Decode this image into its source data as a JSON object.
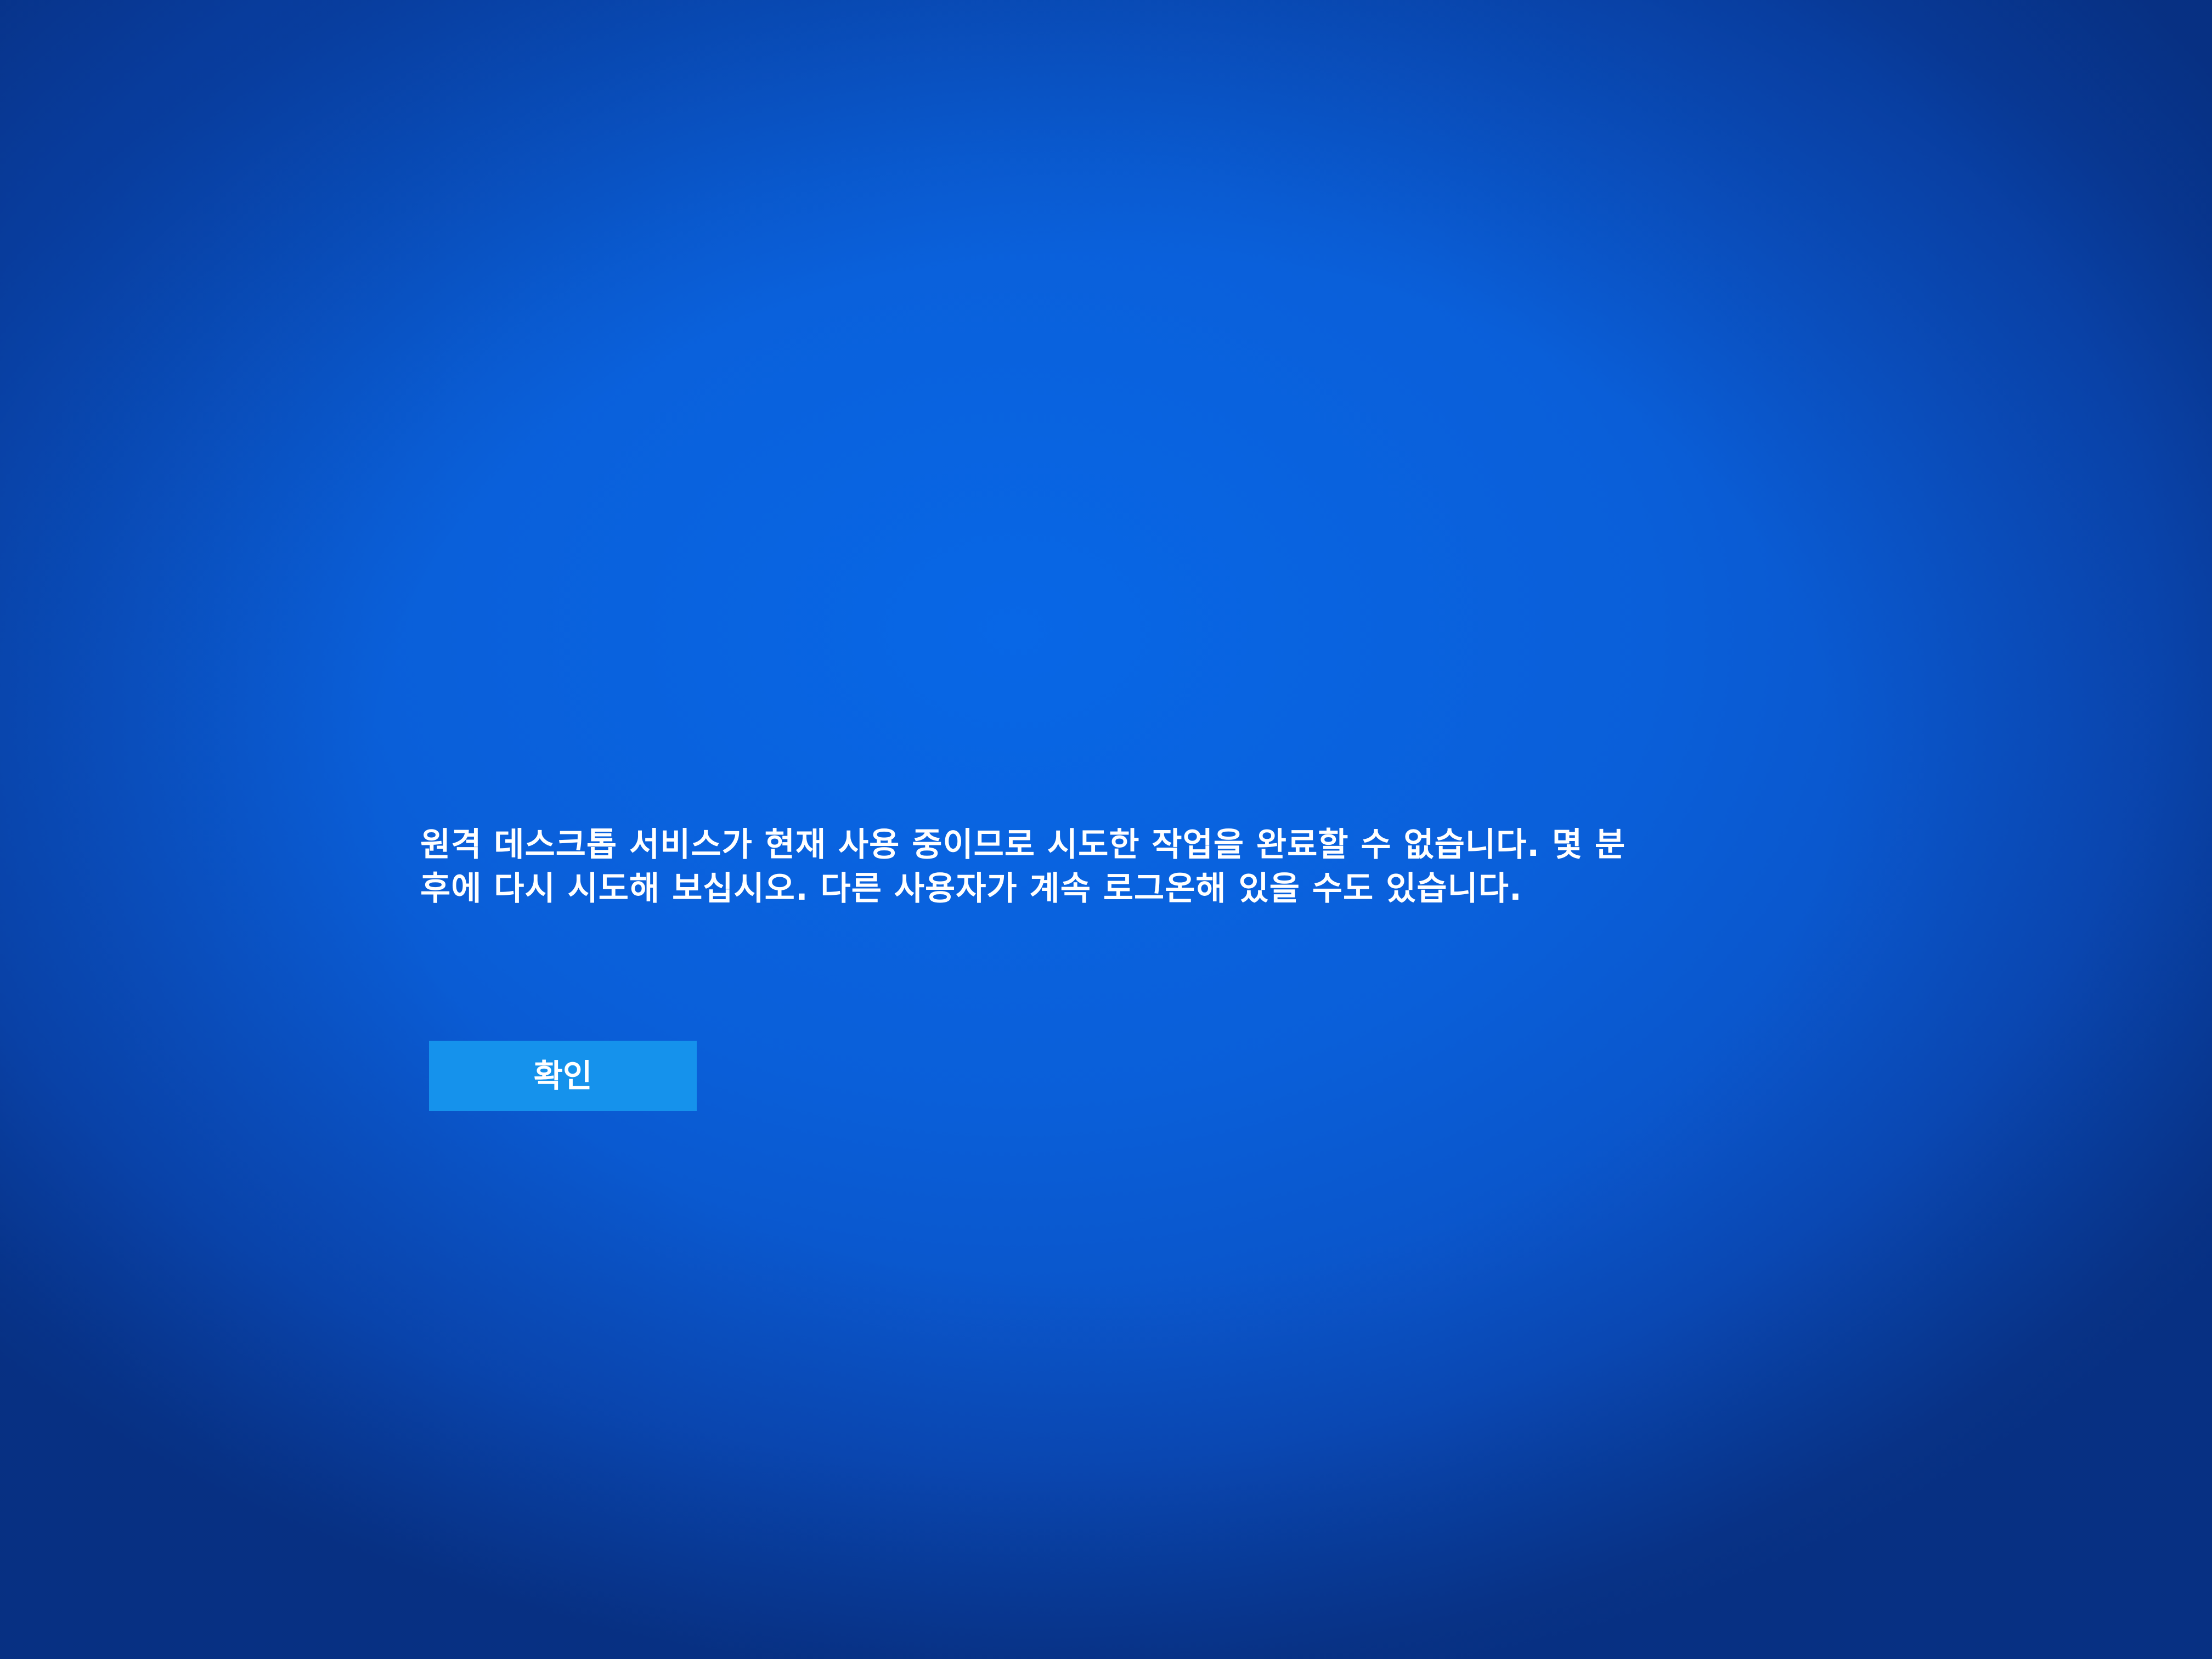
{
  "dialog": {
    "message_line_1": "원격 데스크톱 서비스가 현재 사용 중이므로 시도한 작업을 완료할 수 없습니다. 몇 분",
    "message_line_2": "후에 다시 시도해 보십시오. 다른 사용자가 계속 로그온해 있을 수도 있습니다.",
    "ok_label": "확인"
  },
  "colors": {
    "background": "#0a5fd8",
    "button": "#1592ec",
    "text": "#ffffff"
  }
}
